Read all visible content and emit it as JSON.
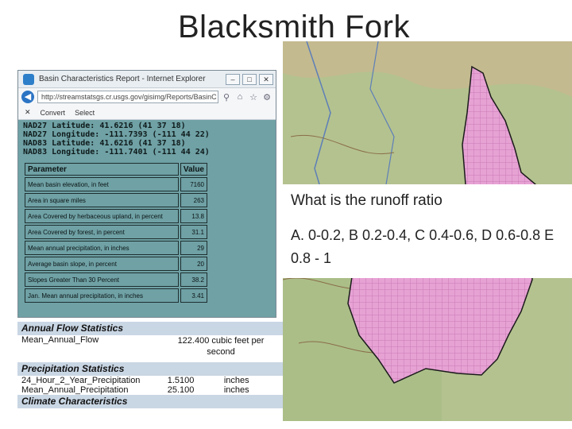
{
  "slide": {
    "title": "Blacksmith Fork"
  },
  "question": {
    "line1": "What is the runoff ratio",
    "line2": "A.  0-0.2,  B 0.2-0.4,  C 0.4-0.6,  D 0.6-0.8  E 0.8 - 1"
  },
  "browser": {
    "title": "Basin Characteristics Report - Internet Explorer",
    "address": "http://streamstatsgs.cr.usgs.gov/gisimg/Reports/BasinC",
    "toolbar": [
      "Convert",
      "Select"
    ],
    "coordinates": [
      "NAD27 Latitude: 41.6216 (41 37 18)",
      "NAD27 Longitude: -111.7393 (-111 44 22)",
      "NAD83 Latitude: 41.6216 (41 37 18)",
      "NAD83 Longitude: -111.7401 (-111 44 24)"
    ],
    "table": {
      "headers": [
        "Parameter",
        "Value"
      ],
      "rows": [
        {
          "param": "Mean basin elevation, in feet",
          "value": "7160"
        },
        {
          "param": "Area in square miles",
          "value": "263"
        },
        {
          "param": "Area Covered by herbaceous upland, in percent",
          "value": "13.8"
        },
        {
          "param": "Area Covered by forest, in percent",
          "value": "31.1"
        },
        {
          "param": "Mean annual precipitation, in inches",
          "value": "29"
        },
        {
          "param": "Average basin slope, in percent",
          "value": "20"
        },
        {
          "param": "Slopes Greater Than 30 Percent",
          "value": "38.2"
        },
        {
          "param": "Jan. Mean annual precipitation, in inches",
          "value": "3.41"
        }
      ]
    }
  },
  "stats": {
    "annual_flow_header": "Annual Flow Statistics",
    "flow": {
      "name": "Mean_Annual_Flow",
      "value": "122.400 cubic feet per second"
    },
    "precip_header": "Precipitation Statistics",
    "precip_rows": [
      {
        "name": "24_Hour_2_Year_Precipitation",
        "value": "1.5100",
        "unit": "inches"
      },
      {
        "name": "Mean_Annual_Precipitation",
        "value": "25.100",
        "unit": "inches"
      }
    ],
    "climate_header": "Climate Characteristics"
  },
  "colors": {
    "ie_content_bg": "#6fa1a5",
    "stats_header_bg": "#c9d6e4",
    "basin_fill": "#e9a6d6"
  },
  "icons": [
    "ie-logo-icon",
    "back-arrow-icon",
    "search-icon",
    "home-icon",
    "favorites-star-icon",
    "settings-gear-icon",
    "minimize-icon",
    "maximize-icon",
    "close-icon"
  ]
}
